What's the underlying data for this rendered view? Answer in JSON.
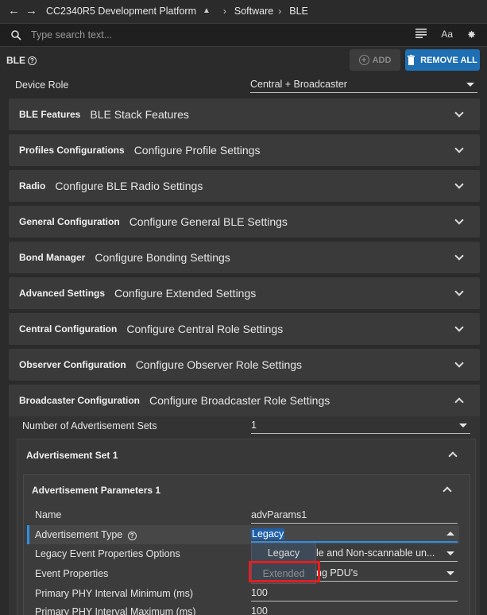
{
  "topbar": {
    "back": "←",
    "forward": "→",
    "platform": "CC2340R5 Development Platform",
    "crumb_software": "Software",
    "crumb_ble": "BLE"
  },
  "search": {
    "placeholder": "Type search text..."
  },
  "module": {
    "title": "BLE",
    "add_label": "ADD",
    "remove_all_label": "REMOVE ALL"
  },
  "device_role": {
    "label": "Device Role",
    "value": "Central + Broadcaster"
  },
  "sections": [
    {
      "name": "BLE Features",
      "desc": "BLE Stack Features"
    },
    {
      "name": "Profiles Configurations",
      "desc": "Configure Profile Settings"
    },
    {
      "name": "Radio",
      "desc": "Configure BLE Radio Settings"
    },
    {
      "name": "General Configuration",
      "desc": "Configure General BLE Settings"
    },
    {
      "name": "Bond Manager",
      "desc": "Configure Bonding Settings"
    },
    {
      "name": "Advanced Settings",
      "desc": "Configure Extended Settings"
    },
    {
      "name": "Central Configuration",
      "desc": "Configure Central Role Settings"
    },
    {
      "name": "Observer Configuration",
      "desc": "Configure Observer Role Settings"
    },
    {
      "name": "Broadcaster Configuration",
      "desc": "Configure Broadcaster Role Settings"
    }
  ],
  "broadcaster": {
    "num_sets_label": "Number of Advertisement Sets",
    "num_sets_value": "1",
    "adv_set_title": "Advertisement Set 1",
    "adv_params_title": "Advertisement Parameters 1",
    "fields": {
      "name_label": "Name",
      "name_value": "advParams1",
      "adv_type_label": "Advertisement Type",
      "adv_type_value": "Legacy",
      "legacy_opts_label": "Legacy Event Properties Options",
      "legacy_opts_value": "le and Non-scannable un...",
      "event_props_label": "Event Properties",
      "event_props_value": "ng PDU's",
      "phy_min_label": "Primary PHY Interval Minimum (ms)",
      "phy_min_value": "100",
      "phy_max_label": "Primary PHY Interval Maximum (ms)",
      "phy_max_value": "100"
    },
    "dropdown_options": [
      "Legacy",
      "Extended"
    ]
  },
  "colors": {
    "accent": "#1e6fb3",
    "highlight": "#e02020"
  }
}
